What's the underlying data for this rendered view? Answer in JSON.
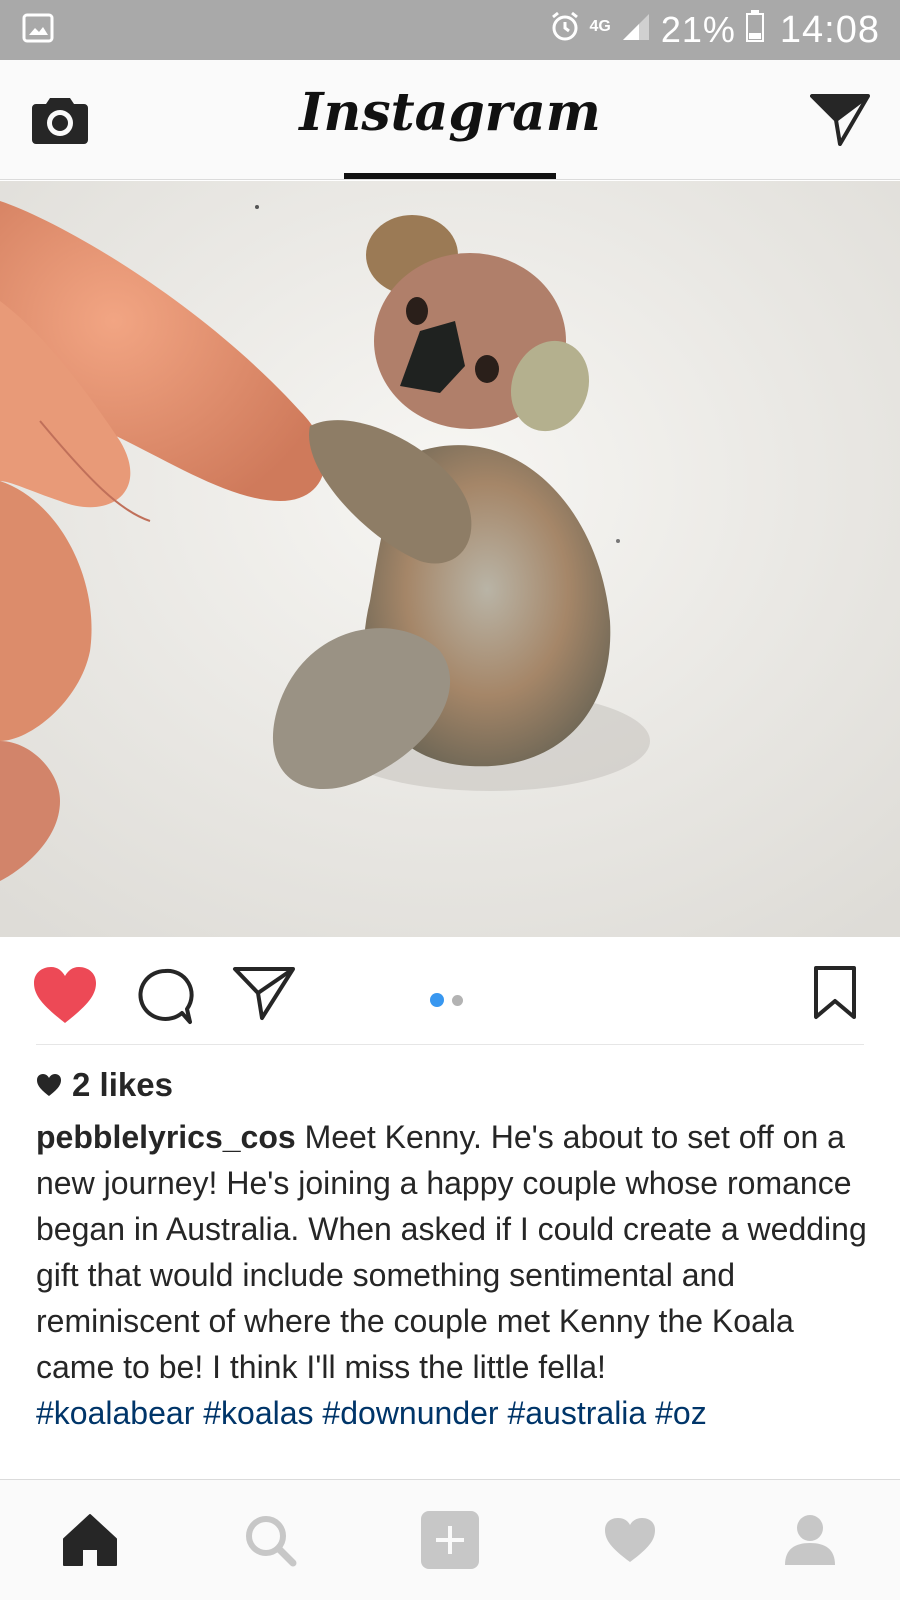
{
  "status_bar": {
    "network": "4G",
    "battery": "21%",
    "time": "14:08",
    "icons": [
      "image-notification-icon",
      "alarm-icon",
      "signal-icon",
      "battery-icon"
    ]
  },
  "header": {
    "title": "Instagram",
    "left_icon": "camera-icon",
    "right_icon": "direct-send-icon"
  },
  "post": {
    "image_alt": "pebble koala held by fingers",
    "actions": {
      "liked": true,
      "like_color": "#ed4956",
      "icons": [
        "heart-icon",
        "comment-icon",
        "share-icon",
        "bookmark-icon"
      ]
    },
    "carousel": {
      "current": 1,
      "total": 2,
      "active_color": "#3897f0"
    },
    "likes": "2 likes",
    "username": "pebblelyrics_cos",
    "caption": " Meet Kenny. He's about to set off on a new journey! He's joining a happy couple whose romance began in Australia. When asked if I could create a wedding gift that would include  something sentimental and reminiscent of where the couple met Kenny the Koala came to be! I think I'll miss the little fella!",
    "hashtags": [
      "#koalabear",
      "#koalas",
      "#downunder",
      "#australia",
      "#oz"
    ],
    "hashtag_color": "#003569"
  },
  "bottom_nav": {
    "tabs": [
      "home-icon",
      "search-icon",
      "add-icon",
      "activity-icon",
      "profile-icon"
    ],
    "active": "home-icon"
  }
}
